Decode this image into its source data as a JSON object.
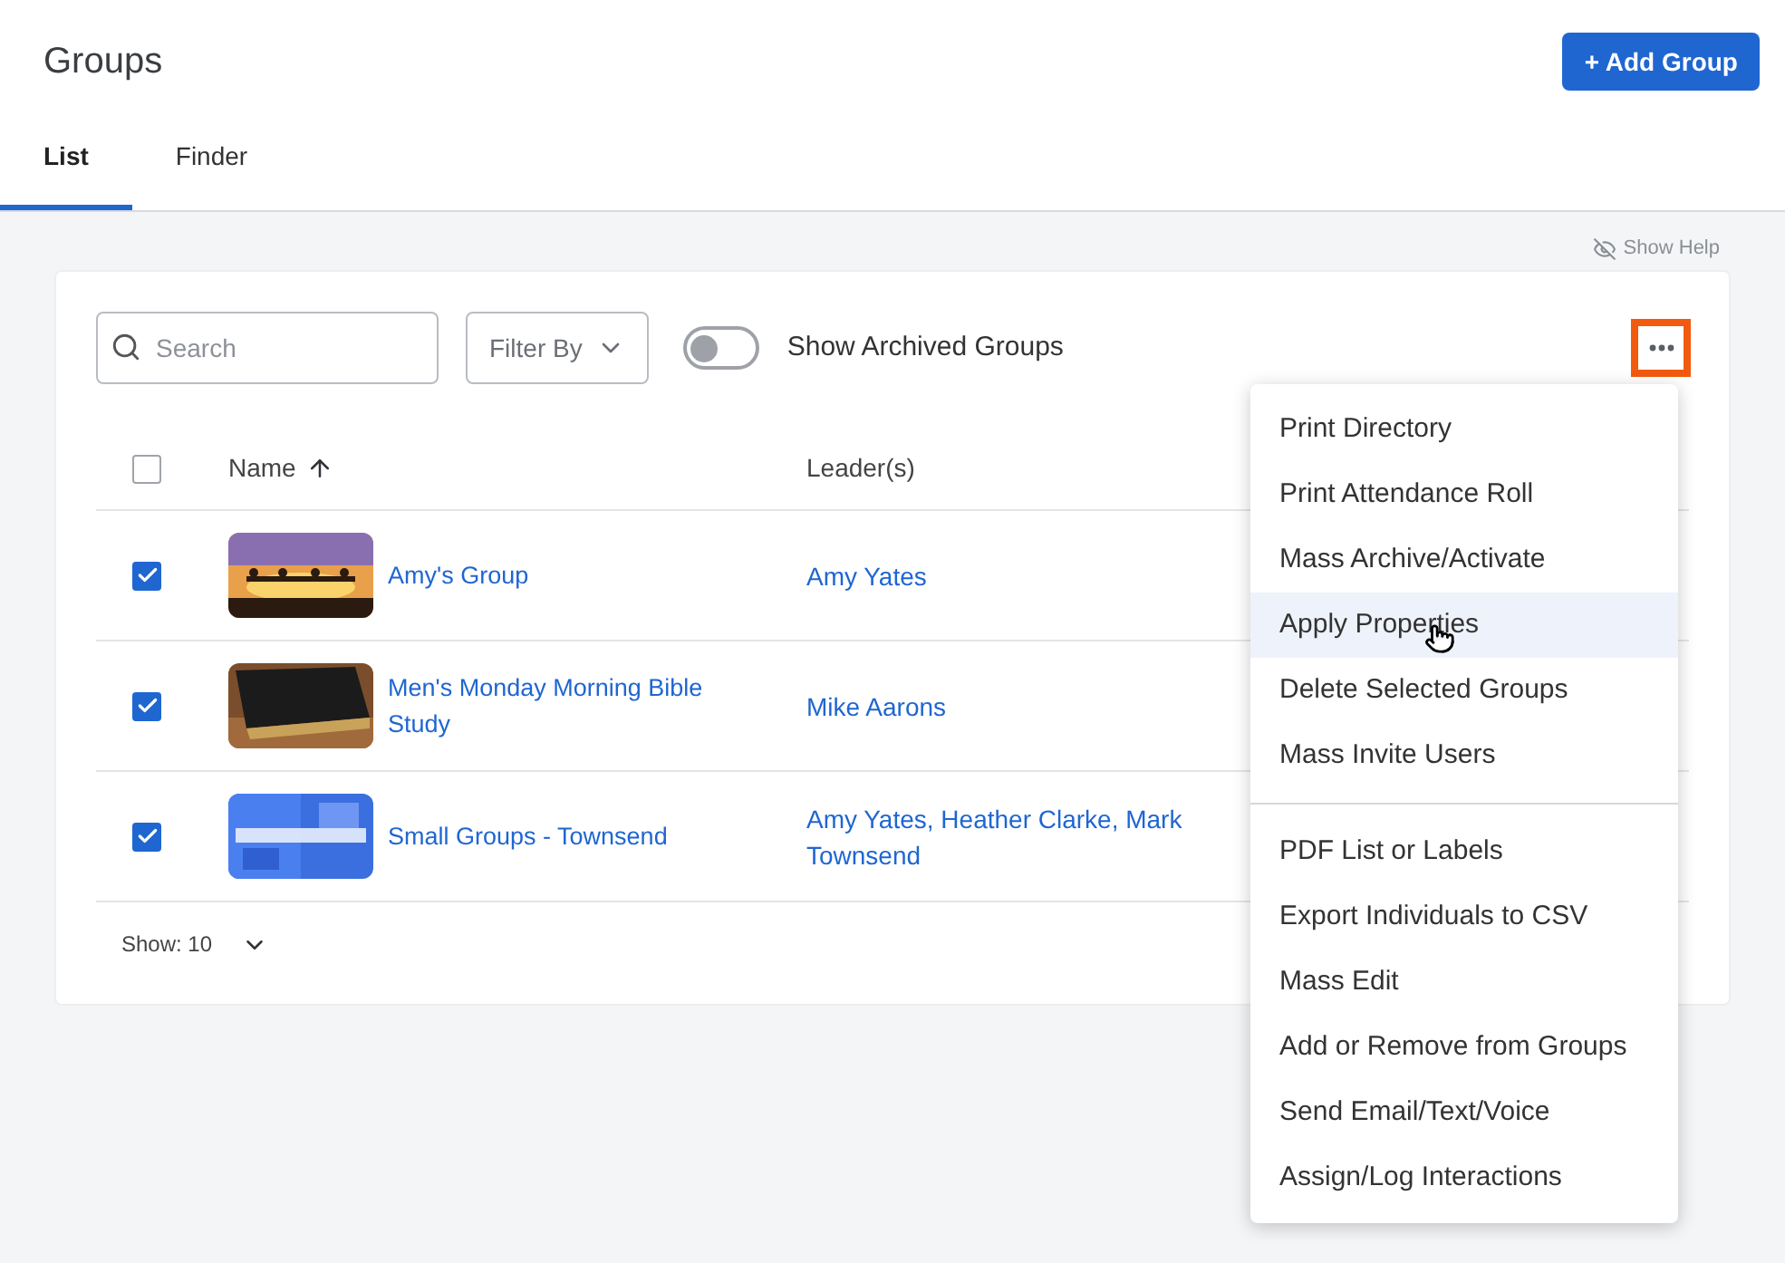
{
  "page": {
    "title": "Groups",
    "add_button": "+ Add Group"
  },
  "tabs": [
    {
      "label": "List",
      "selected": true
    },
    {
      "label": "Finder",
      "selected": false
    }
  ],
  "show_help": "Show Help",
  "toolbar": {
    "search": {
      "placeholder": "Search"
    },
    "filter": {
      "label": "Filter By"
    },
    "archived_toggle": {
      "label": "Show Archived Groups",
      "on": false
    },
    "more_button": {
      "annotated": true
    }
  },
  "table": {
    "select_all": {
      "checked": false
    },
    "columns": [
      {
        "label": "Name",
        "sorted": true
      },
      {
        "label": "Leader(s)",
        "sorted": false
      }
    ],
    "rows": [
      {
        "checked": true,
        "name": "Amy's Group",
        "leaders": "Amy Yates"
      },
      {
        "checked": true,
        "name": "Men's Monday Morning Bible Study",
        "leaders": "Mike Aarons"
      },
      {
        "checked": true,
        "name": "Small Groups - Townsend",
        "leaders": "Amy Yates, Heather Clarke, Mark Townsend"
      }
    ],
    "page_size": "Show: 10"
  },
  "menu": {
    "sections": [
      {
        "items": [
          {
            "label": "Print Directory",
            "highlighted": false
          },
          {
            "label": "Print Attendance Roll",
            "highlighted": false
          },
          {
            "label": "Mass Archive/Activate",
            "highlighted": false
          },
          {
            "label": "Apply Properties",
            "highlighted": true
          },
          {
            "label": "Delete Selected Groups",
            "highlighted": false
          },
          {
            "label": "Mass Invite Users",
            "highlighted": false
          }
        ]
      },
      {
        "items": [
          {
            "label": "PDF List or Labels",
            "highlighted": false
          },
          {
            "label": "Export Individuals to CSV",
            "highlighted": false
          },
          {
            "label": "Mass Edit",
            "highlighted": false
          },
          {
            "label": "Add or Remove from Groups",
            "highlighted": false
          },
          {
            "label": "Send Email/Text/Voice",
            "highlighted": false
          },
          {
            "label": "Assign/Log Interactions",
            "highlighted": false
          }
        ]
      }
    ]
  }
}
